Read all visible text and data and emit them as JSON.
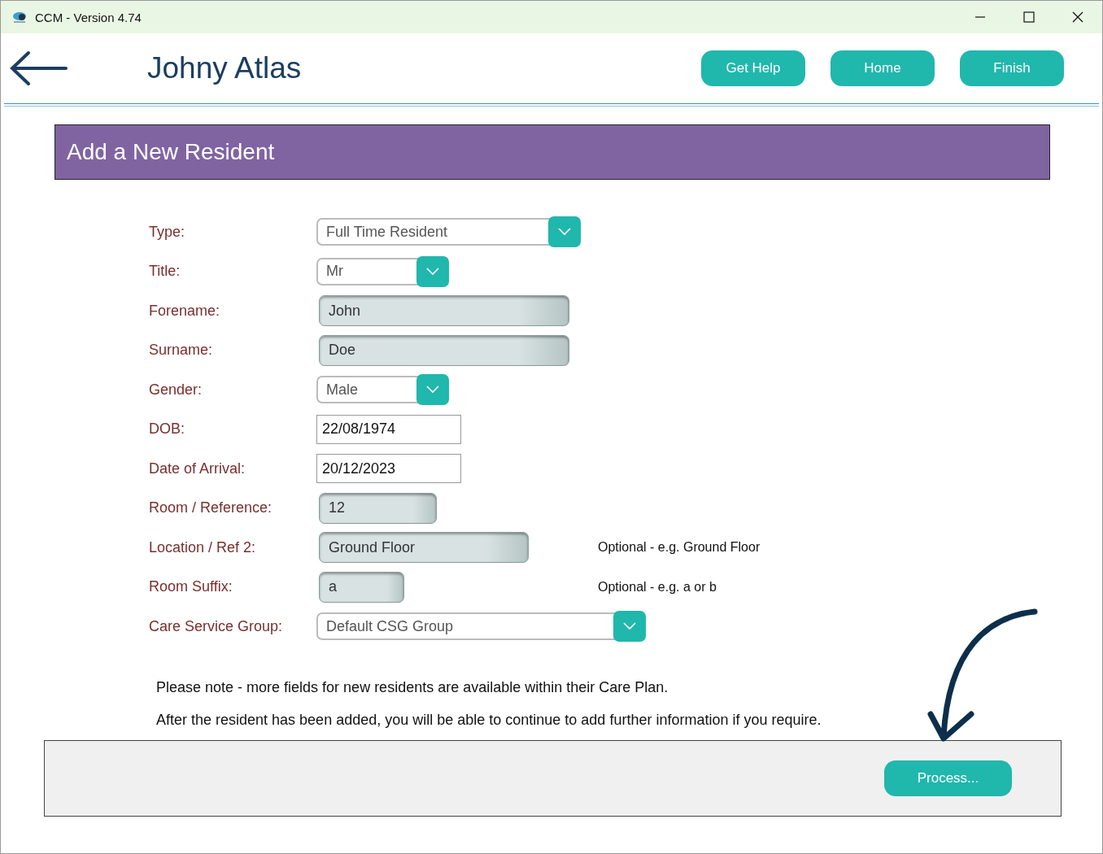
{
  "window": {
    "title": "CCM - Version 4.74"
  },
  "header": {
    "name": "Johny Atlas",
    "buttons": [
      "Get Help",
      "Home",
      "Finish"
    ]
  },
  "banner": {
    "title": "Add a New Resident"
  },
  "form": {
    "fields": [
      {
        "label": "Type:",
        "kind": "dropdown",
        "value": "Full Time Resident"
      },
      {
        "label": "Title:",
        "kind": "dropdown",
        "value": "Mr"
      },
      {
        "label": "Forename:",
        "kind": "shaded",
        "value": "John"
      },
      {
        "label": "Surname:",
        "kind": "shaded",
        "value": "Doe"
      },
      {
        "label": "Gender:",
        "kind": "dropdown",
        "value": "Male"
      },
      {
        "label": "DOB:",
        "kind": "plain",
        "value": "22/08/1974"
      },
      {
        "label": "Date of Arrival:",
        "kind": "plain",
        "value": "20/12/2023"
      },
      {
        "label": "Room / Reference:",
        "kind": "shaded",
        "value": "12"
      },
      {
        "label": "Location / Ref 2:",
        "kind": "shaded",
        "value": "Ground Floor",
        "hint": "Optional - e.g. Ground Floor"
      },
      {
        "label": "Room Suffix:",
        "kind": "shaded",
        "value": "a",
        "hint": "Optional - e.g. a or b"
      },
      {
        "label": "Care Service Group:",
        "kind": "dropdown",
        "value": "Default CSG Group"
      }
    ]
  },
  "notes": [
    "Please note - more fields for new residents are available within their Care Plan.",
    "After the resident has been added, you will be able to continue to add further information if you require."
  ],
  "footer": {
    "button": "Process..."
  }
}
